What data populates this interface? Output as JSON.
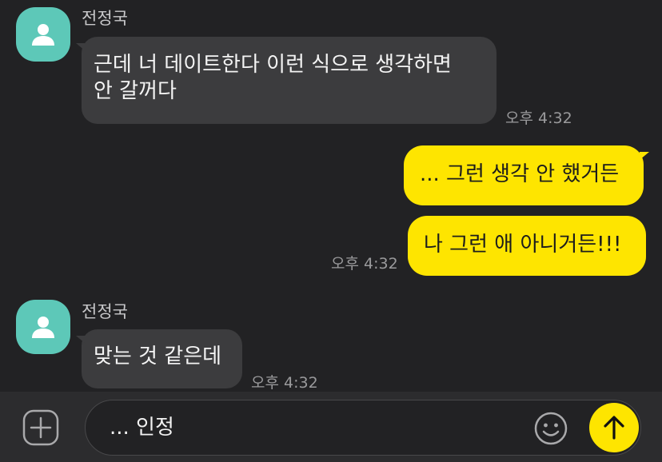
{
  "colors": {
    "background": "#222224",
    "incoming_bubble": "#3c3c3e",
    "outgoing_bubble": "#fee500",
    "avatar": "#5dc8b8",
    "timestamp": "#9a9a9c"
  },
  "messages": [
    {
      "direction": "incoming",
      "sender": "전정국",
      "avatar_icon": "person-icon",
      "lines": [
        "근데 너 데이트한다 이런 식으로 생각하면",
        "안 갈꺼다"
      ],
      "time": "오후 4:32"
    },
    {
      "direction": "outgoing",
      "text": "... 그런 생각 안 했거든"
    },
    {
      "direction": "outgoing",
      "text": "나 그런 애 아니거든!!!",
      "time": "오후 4:32"
    },
    {
      "direction": "incoming",
      "sender": "전정국",
      "avatar_icon": "person-icon",
      "lines": [
        "맞는 것 같은데"
      ],
      "time": "오후 4:32"
    }
  ],
  "composer": {
    "plus_icon": "plus-square-icon",
    "text": "... 인정",
    "emoji_icon": "smiley-icon",
    "send_icon": "arrow-up-icon"
  }
}
